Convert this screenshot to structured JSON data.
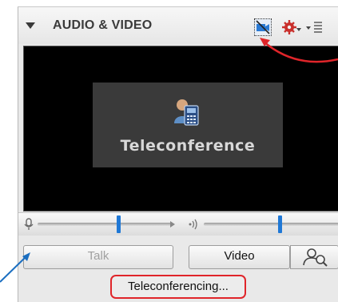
{
  "panel": {
    "title": "AUDIO & VIDEO",
    "toolbar": {
      "camera_icon": "video-camera-icon",
      "settings_icon": "gear-icon",
      "menu_icon": "list-menu-icon"
    }
  },
  "video": {
    "tile_label": "Teleconference",
    "tile_icon": "teleconference-icon"
  },
  "sliders": {
    "mic": {
      "icon": "microphone-icon",
      "level": 0.58
    },
    "speaker": {
      "icon": "speaker-icon",
      "level": 0.55
    }
  },
  "buttons": {
    "talk": "Talk",
    "video": "Video",
    "people_icon": "people-search-icon"
  },
  "status": "Teleconferencing...",
  "colors": {
    "accent": "#1f78d6",
    "annotation_red": "#e0252a",
    "annotation_blue": "#1a6ec0"
  }
}
